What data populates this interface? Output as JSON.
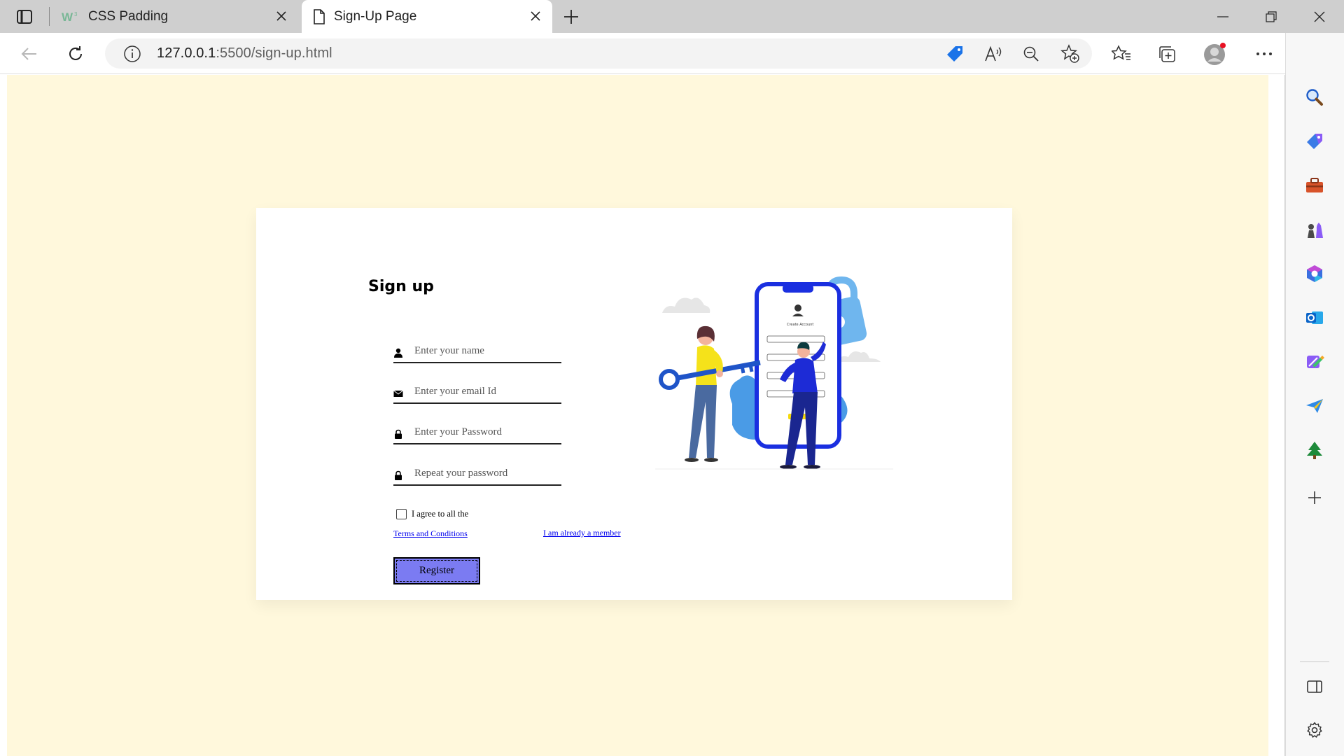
{
  "browser": {
    "tabs": [
      {
        "title": "CSS Padding",
        "icon": "w3schools-icon",
        "active": false
      },
      {
        "title": "Sign-Up Page",
        "icon": "page-icon",
        "active": true
      }
    ],
    "url_host": "127.0.0.1",
    "url_path": ":5500/sign-up.html"
  },
  "form": {
    "title": "Sign up",
    "fields": [
      {
        "placeholder": "Enter your name",
        "icon": "user-icon"
      },
      {
        "placeholder": "Enter your email Id",
        "icon": "envelope-icon"
      },
      {
        "placeholder": "Enter your Password",
        "icon": "lock-icon"
      },
      {
        "placeholder": "Repeat your password",
        "icon": "lock-icon"
      }
    ],
    "agree_text": "I agree to all the",
    "terms_link": "Terms and Conditions",
    "member_link": "I am already a member",
    "register_label": "Register"
  },
  "colors": {
    "page_background": "#fff8dc",
    "register_button": "#7b7bf2",
    "link": "#0000ee"
  }
}
